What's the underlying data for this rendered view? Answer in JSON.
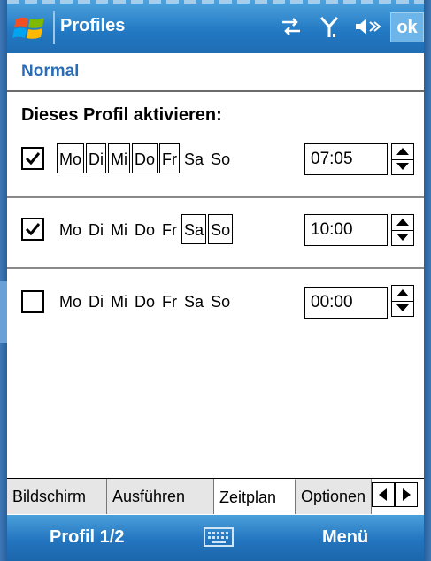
{
  "app": {
    "title": "Profiles",
    "ok_label": "ok"
  },
  "profile": {
    "name": "Normal"
  },
  "schedule": {
    "heading": "Dieses Profil aktivieren:",
    "rows": [
      {
        "checked": true,
        "days": [
          {
            "label": "Mo",
            "selected": true
          },
          {
            "label": "Di",
            "selected": true
          },
          {
            "label": "Mi",
            "selected": true
          },
          {
            "label": "Do",
            "selected": true
          },
          {
            "label": "Fr",
            "selected": true
          },
          {
            "label": "Sa",
            "selected": false
          },
          {
            "label": "So",
            "selected": false
          }
        ],
        "time": "07:05"
      },
      {
        "checked": true,
        "days": [
          {
            "label": "Mo",
            "selected": false
          },
          {
            "label": "Di",
            "selected": false
          },
          {
            "label": "Mi",
            "selected": false
          },
          {
            "label": "Do",
            "selected": false
          },
          {
            "label": "Fr",
            "selected": false
          },
          {
            "label": "Sa",
            "selected": true
          },
          {
            "label": "So",
            "selected": true
          }
        ],
        "time": "10:00"
      },
      {
        "checked": false,
        "days": [
          {
            "label": "Mo",
            "selected": false
          },
          {
            "label": "Di",
            "selected": false
          },
          {
            "label": "Mi",
            "selected": false
          },
          {
            "label": "Do",
            "selected": false
          },
          {
            "label": "Fr",
            "selected": false
          },
          {
            "label": "Sa",
            "selected": false
          },
          {
            "label": "So",
            "selected": false
          }
        ],
        "time": "00:00"
      }
    ]
  },
  "tabs": [
    {
      "label": "Bildschirm",
      "active": false
    },
    {
      "label": "Ausführen",
      "active": false
    },
    {
      "label": "Zeitplan",
      "active": true
    },
    {
      "label": "Optionen",
      "active": false
    }
  ],
  "softkeys": {
    "left": "Profil 1/2",
    "right": "Menü"
  },
  "icons": [
    "windows-start-icon",
    "connectivity-icon",
    "signal-icon",
    "speaker-icon",
    "keyboard-icon"
  ],
  "colors": {
    "accent": "#2278c2",
    "subtitle": "#2a6db5"
  }
}
